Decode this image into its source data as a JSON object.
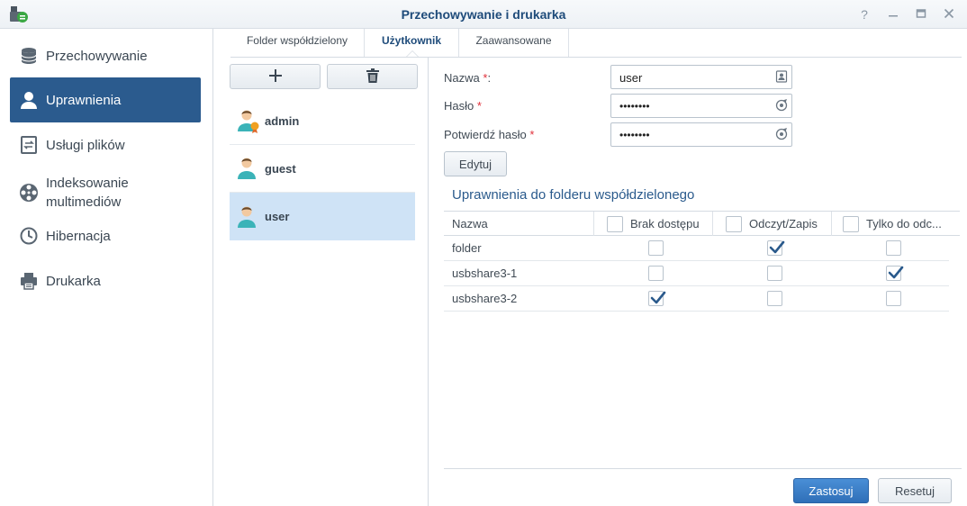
{
  "window": {
    "title": "Przechowywanie i drukarka"
  },
  "sidebar": {
    "items": [
      {
        "label": "Przechowywanie",
        "icon": "storage-icon"
      },
      {
        "label": "Uprawnienia",
        "icon": "user-icon"
      },
      {
        "label": "Usługi plików",
        "icon": "file-services-icon"
      },
      {
        "label": "Indeksowanie multimediów",
        "icon": "media-index-icon"
      },
      {
        "label": "Hibernacja",
        "icon": "clock-icon"
      },
      {
        "label": "Drukarka",
        "icon": "printer-icon"
      }
    ],
    "active": "Uprawnienia"
  },
  "tabs": [
    {
      "label": "Folder współdzielony"
    },
    {
      "label": "Użytkownik"
    },
    {
      "label": "Zaawansowane"
    }
  ],
  "users": [
    {
      "name": "admin"
    },
    {
      "name": "guest"
    },
    {
      "name": "user"
    }
  ],
  "form": {
    "name_label": "Nazwa",
    "name_suffix": ":",
    "password_label": "Hasło",
    "confirm_label": "Potwierdź hasło",
    "required_mark": "*",
    "name_value": "user",
    "password_value": "••••••••",
    "confirm_value": "••••••••",
    "edit_button": "Edytuj"
  },
  "permissions": {
    "title": "Uprawnienia do folderu współdzielonego",
    "columns": [
      "Nazwa",
      "Brak dostępu",
      "Odczyt/Zapis",
      "Tylko do odc..."
    ],
    "rows": [
      {
        "name": "folder",
        "no_access": false,
        "read_write": true,
        "read_only": false
      },
      {
        "name": "usbshare3-1",
        "no_access": false,
        "read_write": false,
        "read_only": true
      },
      {
        "name": "usbshare3-2",
        "no_access": true,
        "read_write": false,
        "read_only": false
      }
    ]
  },
  "footer": {
    "apply_button": "Zastosuj",
    "reset_button": "Resetuj"
  },
  "colors": {
    "accent": "#2b5b8e",
    "selected_row": "#cfe3f6",
    "check": "#2a5a8c",
    "required": "#e0303a"
  }
}
